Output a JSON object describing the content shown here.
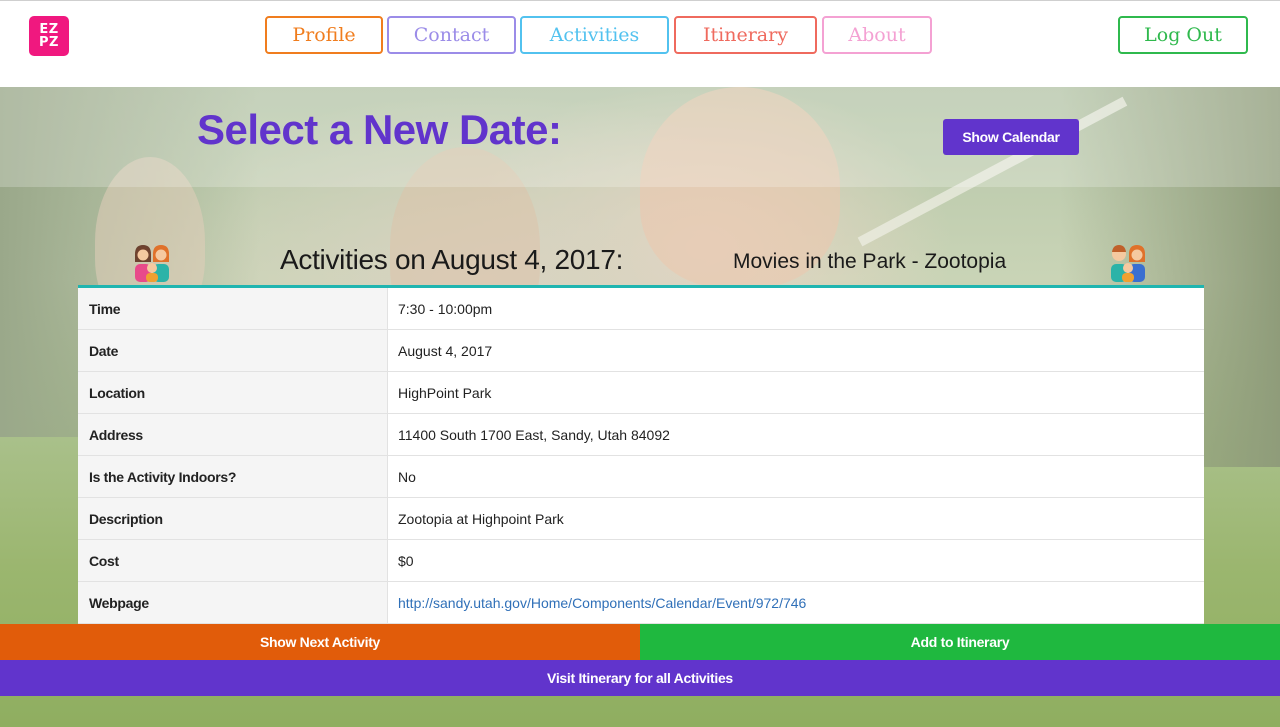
{
  "logo": {
    "line1": "EZ",
    "line2": "PZ"
  },
  "nav": {
    "profile": "Profile",
    "contact": "Contact",
    "activities": "Activities",
    "itinerary": "Itinerary",
    "about": "About",
    "logout": "Log Out"
  },
  "colors": {
    "profile": "#f07d1e",
    "contact": "#9b8ce8",
    "activities": "#52c2ef",
    "itinerary": "#ef6a5e",
    "about": "#f4a1d3",
    "logout": "#2fb94d",
    "accent_purple": "#6134cc",
    "next_orange": "#e15c0a",
    "add_green": "#1fb83f",
    "table_teal": "#1fb5b0"
  },
  "hero": {
    "title": "Select a New Date:",
    "calendar_button": "Show Calendar"
  },
  "activity": {
    "heading": "Activities on August 4, 2017:",
    "name": "Movies in the Park - Zootopia",
    "left_icon": "family-women-child-icon",
    "right_icon": "family-man-woman-child-icon"
  },
  "details": [
    {
      "label": "Time",
      "value": "7:30 - 10:00pm"
    },
    {
      "label": "Date",
      "value": "August 4, 2017"
    },
    {
      "label": "Location",
      "value": "HighPoint Park"
    },
    {
      "label": "Address",
      "value": "11400 South 1700 East, Sandy, Utah 84092"
    },
    {
      "label": "Is the Activity Indoors?",
      "value": "No"
    },
    {
      "label": "Description",
      "value": "Zootopia at Highpoint Park"
    },
    {
      "label": "Cost",
      "value": "$0"
    },
    {
      "label": "Webpage",
      "value": "http://sandy.utah.gov/Home/Components/Calendar/Event/972/746"
    }
  ],
  "actions": {
    "next": "Show Next Activity",
    "add": "Add to Itinerary",
    "visit": "Visit Itinerary for all Activities"
  }
}
